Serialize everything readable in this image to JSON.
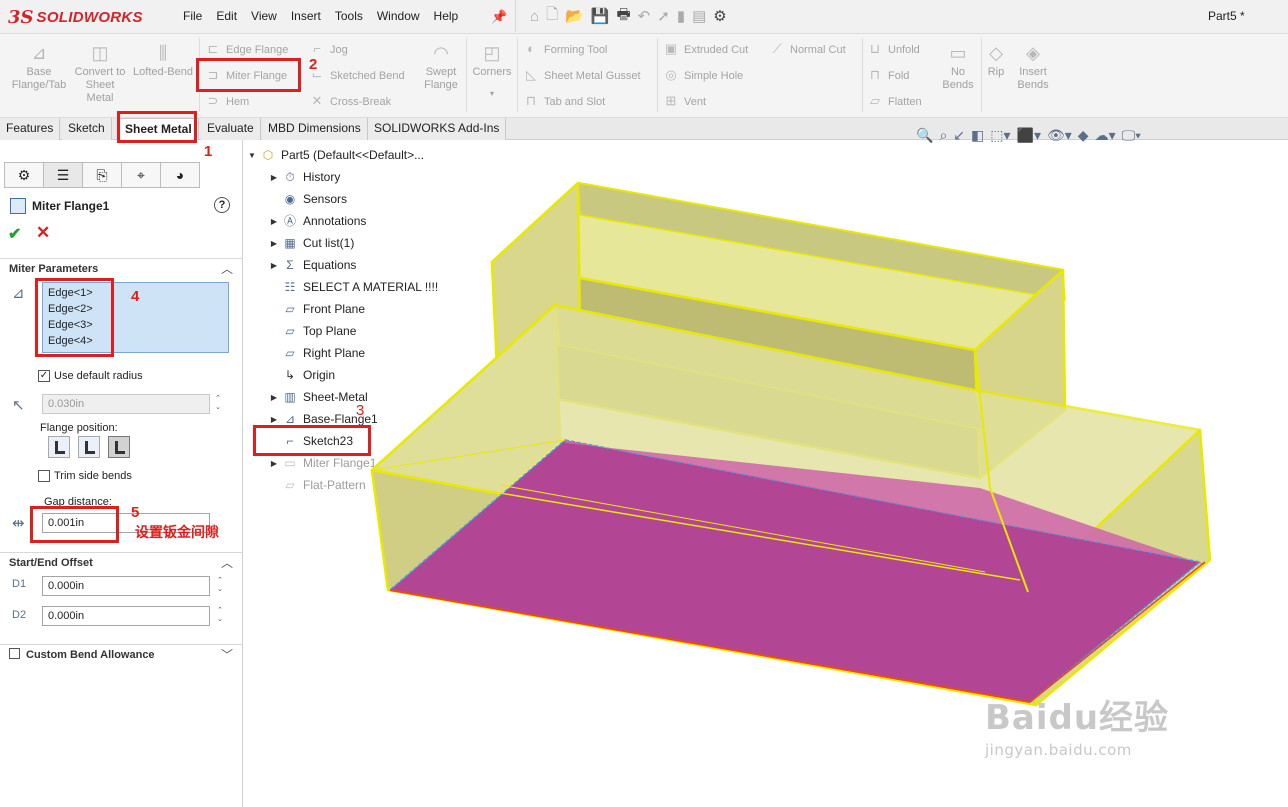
{
  "app": {
    "logo_mark": "3S",
    "logo_text": "SOLIDWORKS",
    "document_title": "Part5 *"
  },
  "menu": [
    "File",
    "Edit",
    "View",
    "Insert",
    "Tools",
    "Window",
    "Help"
  ],
  "ribbon": {
    "big": {
      "base_flange": "Base Flange/Tab",
      "convert": "Convert to Sheet Metal",
      "lofted_bend": "Lofted-Bend",
      "swept_flange": "Swept Flange",
      "corners": "Corners",
      "no_bends": "No Bends",
      "rip": "Rip",
      "insert_bends": "Insert Bends"
    },
    "small": {
      "edge_flange": "Edge Flange",
      "miter_flange": "Miter Flange",
      "hem": "Hem",
      "jog": "Jog",
      "sketched_bend": "Sketched Bend",
      "cross_break": "Cross-Break",
      "forming_tool": "Forming Tool",
      "sheet_metal_gusset": "Sheet Metal Gusset",
      "tab_and_slot": "Tab and Slot",
      "extruded_cut": "Extruded Cut",
      "normal_cut": "Normal Cut",
      "simple_hole": "Simple Hole",
      "vent": "Vent",
      "unfold": "Unfold",
      "fold": "Fold",
      "flatten": "Flatten"
    }
  },
  "tabs": [
    "Features",
    "Sketch",
    "Sheet Metal",
    "Evaluate",
    "MBD Dimensions",
    "SOLIDWORKS Add-Ins"
  ],
  "property_manager": {
    "title": "Miter Flange1",
    "help": "?",
    "ok": "✔",
    "cancel": "✕",
    "section_params": "Miter Parameters",
    "edges": [
      "Edge<1>",
      "Edge<2>",
      "Edge<3>",
      "Edge<4>"
    ],
    "use_default_radius": "Use default radius",
    "radius_value": "0.030in",
    "flange_position_label": "Flange position:",
    "trim_side_bends": "Trim side bends",
    "gap_label": "Gap distance:",
    "gap_value": "0.001in",
    "section_offset": "Start/End Offset",
    "start_offset": "0.000in",
    "end_offset": "0.000in",
    "section_custom": "Custom Bend Allowance",
    "d1": "D1",
    "d2": "D2"
  },
  "tree": {
    "root": "Part5  (Default<<Default>...",
    "items": [
      "History",
      "Sensors",
      "Annotations",
      "Cut list(1)",
      "Equations",
      "SELECT A MATERIAL !!!!",
      "Front Plane",
      "Top Plane",
      "Right Plane",
      "Origin",
      "Sheet-Metal",
      "Base-Flange1",
      "Sketch23",
      "Miter Flange1",
      "Flat-Pattern"
    ]
  },
  "annotations": {
    "n1": "1",
    "n2": "2",
    "n3": "3",
    "n4": "4",
    "n5": "5",
    "note": "设置钣金间隙"
  },
  "watermark": {
    "brand": "Baidu经验",
    "url": "jingyan.baidu.com"
  },
  "colors": {
    "accent_red": "#e01e1e",
    "model_outline": "#f0f000",
    "model_fill": "#cdcc6e",
    "flange_face": "#b9489a"
  }
}
